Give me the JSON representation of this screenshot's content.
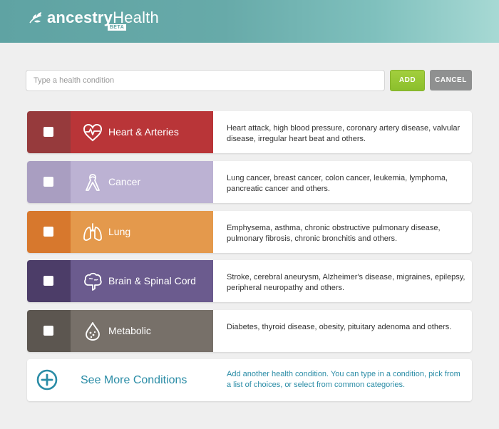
{
  "header": {
    "logo_brand": "ancestry",
    "logo_product": "Health",
    "badge": "BETA"
  },
  "search": {
    "placeholder": "Type a health condition",
    "value": ""
  },
  "actions": {
    "add_label": "ADD",
    "cancel_label": "CANCEL"
  },
  "conditions": [
    {
      "label": "Heart & Arteries",
      "icon": "heart-pulse-icon",
      "description": "Heart attack, high blood pressure, coronary artery disease, valvular disease, irregular heart beat and others.",
      "check_color": "#963a3c",
      "label_color": "#b93538",
      "checked": false
    },
    {
      "label": "Cancer",
      "icon": "awareness-ribbon-icon",
      "description": "Lung cancer, breast cancer, colon cancer, leukemia, lymphoma, pancreatic cancer and others.",
      "check_color": "#a99ec1",
      "label_color": "#bcb2d3",
      "checked": false
    },
    {
      "label": "Lung",
      "icon": "lungs-icon",
      "description": "Emphysema, asthma, chronic obstructive pulmonary disease, pulmonary fibrosis, chronic bronchitis and others.",
      "check_color": "#d7782d",
      "label_color": "#e4994c",
      "checked": false
    },
    {
      "label": "Brain & Spinal Cord",
      "icon": "brain-icon",
      "description": "Stroke, cerebral aneurysm, Alzheimer's disease, migraines, epilepsy, peripheral neuropathy and others.",
      "check_color": "#4c3d68",
      "label_color": "#6b5b8e",
      "checked": false
    },
    {
      "label": "Metabolic",
      "icon": "droplet-icon",
      "description": "Diabetes, thyroid disease, obesity, pituitary adenoma and others.",
      "check_color": "#5c5650",
      "label_color": "#777069",
      "checked": false
    }
  ],
  "see_more": {
    "label": "See More Conditions",
    "description": "Add another health condition. You can type in a condition, pick from a list of choices, or select from common categories.",
    "icon": "plus-circle-icon",
    "color": "#2a8ca6"
  }
}
